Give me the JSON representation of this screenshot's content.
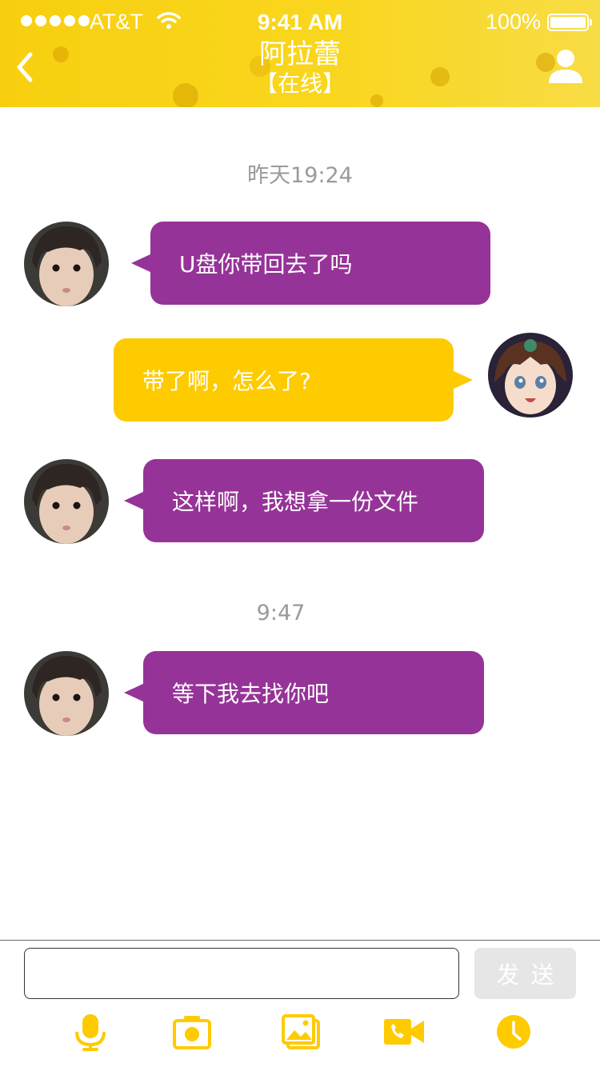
{
  "status_bar": {
    "carrier": "AT&T",
    "time": "9:41 AM",
    "battery": "100%"
  },
  "header": {
    "title": "阿拉蕾",
    "status": "【在线】"
  },
  "messages": {
    "timestamp_1": "昨天19:24",
    "msg_1": "U盘你带回去了吗",
    "msg_2": "带了啊，怎么了?",
    "msg_3": "这样啊，我想拿一份文件",
    "timestamp_2": "9:47",
    "msg_4": "等下我去找你吧"
  },
  "input_bar": {
    "placeholder": "",
    "send_label": "发送"
  },
  "toolbar": {
    "icons": [
      "microphone-icon",
      "camera-icon",
      "image-icon",
      "video-call-icon",
      "clock-icon"
    ]
  },
  "colors": {
    "accent": "#fecb00",
    "incoming_bubble": "#963398",
    "outgoing_bubble": "#fecb00",
    "timestamp": "#9a9a9a",
    "send_disabled": "#e6e6e6"
  }
}
